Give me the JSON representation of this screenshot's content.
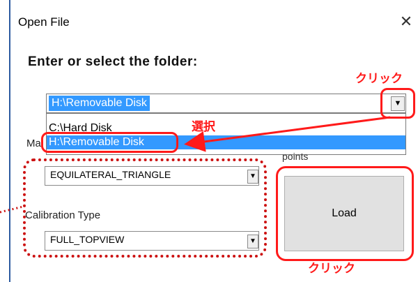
{
  "window": {
    "title": "Open File",
    "close_glyph": "✕"
  },
  "folder": {
    "label": "Enter or select the folder:",
    "value": "H:\\Removable Disk",
    "options": [
      "C:\\Hard Disk",
      "H:\\Removable Disk"
    ],
    "selected_index": 1
  },
  "fields": {
    "marker_label_partial": "Ma",
    "points_label": "points",
    "shape_value": "EQUILATERAL_TRIANGLE",
    "calibration_label": "Calibration Type",
    "calibration_value": "FULL_TOPVIEW"
  },
  "buttons": {
    "load_label": "Load"
  },
  "annotations": {
    "click_top": "クリック",
    "select": "選択",
    "click_bottom": "クリック",
    "color": "#ff1a1a"
  },
  "icons": {
    "dropdown": "chevron-down-icon",
    "close": "close-icon"
  }
}
